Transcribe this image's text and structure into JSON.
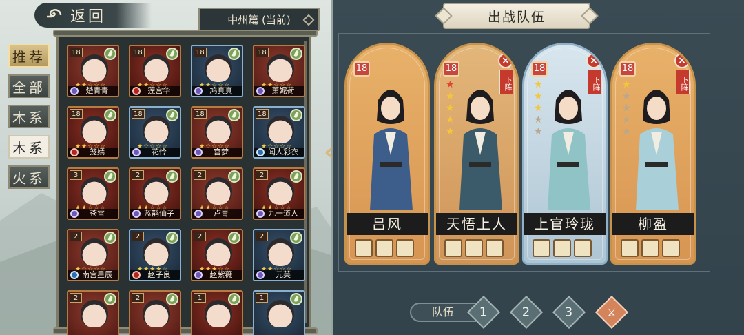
{
  "header": {
    "back_label": "返回",
    "chapter": "中州篇 (当前)"
  },
  "tabs": [
    "推荐",
    "全部",
    "木系",
    "木系",
    "火系"
  ],
  "roster": [
    {
      "name": "楚青青",
      "level": "18",
      "stars": "★★☆☆☆",
      "type": "spiral"
    },
    {
      "name": "莲宫华",
      "level": "18",
      "stars": "★★☆☆☆",
      "type": "fire"
    },
    {
      "name": "鸠真真",
      "level": "18",
      "stars": "★★☆☆☆",
      "type": "spiral"
    },
    {
      "name": "萧妮荷",
      "level": "18",
      "stars": "★★☆☆☆",
      "type": "spiral"
    },
    {
      "name": "笼嫣",
      "level": "18",
      "stars": "★★☆☆☆",
      "type": "fire"
    },
    {
      "name": "花怜",
      "level": "18",
      "stars": "★☆☆☆☆",
      "type": "spiral"
    },
    {
      "name": "宫梦",
      "level": "18",
      "stars": "★☆☆☆☆",
      "type": "spiral"
    },
    {
      "name": "闻人彩衣",
      "level": "18",
      "stars": "★☆☆☆☆",
      "type": "shield"
    },
    {
      "name": "苍雪",
      "level": "3",
      "stars": "★★☆☆☆",
      "type": "spiral"
    },
    {
      "name": "蓝鹊仙子",
      "level": "2",
      "stars": "★★☆☆☆",
      "type": "spiral"
    },
    {
      "name": "卢青",
      "level": "2",
      "stars": "★★☆☆☆",
      "type": "spiral"
    },
    {
      "name": "九一道人",
      "level": "2",
      "stars": "★★☆☆☆",
      "type": "spiral"
    },
    {
      "name": "南宫星辰",
      "level": "2",
      "stars": "★☆☆☆☆",
      "type": "shield"
    },
    {
      "name": "赵子良",
      "level": "2",
      "stars": "★★★★☆",
      "type": "fire"
    },
    {
      "name": "赵紫薇",
      "level": "2",
      "stars": "★★★☆☆",
      "type": "spiral"
    },
    {
      "name": "元芙",
      "level": "2",
      "stars": "★★☆☆☆",
      "type": "spiral"
    },
    {
      "name": "",
      "level": "2",
      "stars": "",
      "type": ""
    },
    {
      "name": "",
      "level": "2",
      "stars": "",
      "type": ""
    },
    {
      "name": "",
      "level": "1",
      "stars": "",
      "type": ""
    },
    {
      "name": "",
      "level": "1",
      "stars": "",
      "type": ""
    }
  ],
  "team": {
    "title": "出战队伍",
    "remove_label": "下阵",
    "members": [
      {
        "name": "吕风",
        "level": "18",
        "removable": false
      },
      {
        "name": "天悟上人",
        "level": "18",
        "removable": true
      },
      {
        "name": "上官玲珑",
        "level": "18",
        "removable": true
      },
      {
        "name": "柳盈",
        "level": "18",
        "removable": true
      }
    ],
    "selector_label": "队伍",
    "team_numbers": [
      "1",
      "2",
      "3"
    ]
  },
  "colors": {
    "accent_gold": "#c7924b",
    "panel": "#3b4b54",
    "remove_red": "#c53a2d"
  }
}
